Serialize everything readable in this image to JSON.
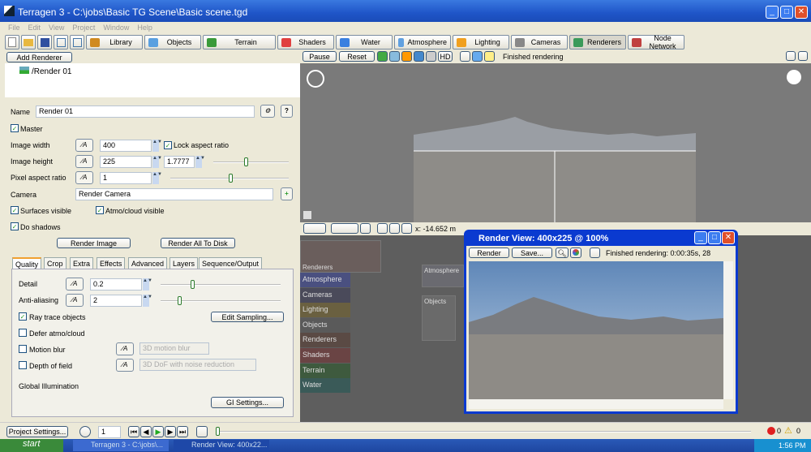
{
  "window": {
    "title": "Terragen 3 - C:\\jobs\\Basic TG Scene\\Basic scene.tgd",
    "minimize": "_",
    "maximize": "□",
    "close": "✕"
  },
  "menu": [
    "File",
    "Edit",
    "View",
    "Project",
    "Window",
    "Help"
  ],
  "toolbar": {
    "tabs": [
      {
        "label": "Library",
        "icon": "library-icon",
        "color": "#d08a20"
      },
      {
        "label": "Objects",
        "icon": "cube-icon",
        "color": "#5aa0e0"
      },
      {
        "label": "Terrain",
        "icon": "terrain-icon",
        "color": "#3a9a3a"
      },
      {
        "label": "Shaders",
        "icon": "sphere-icon",
        "color": "#e04040"
      },
      {
        "label": "Water",
        "icon": "water-drop-icon",
        "color": "#3a80e0"
      },
      {
        "label": "Atmosphere",
        "icon": "cloud-icon",
        "color": "#60a0e0"
      },
      {
        "label": "Lighting",
        "icon": "sun-icon",
        "color": "#f0a020"
      },
      {
        "label": "Cameras",
        "icon": "camera-icon",
        "color": "#888888"
      },
      {
        "label": "Renderers",
        "icon": "render-icon",
        "color": "#3a9a5a"
      },
      {
        "label": "Node Network",
        "icon": "node-network-icon",
        "color": "#c04040"
      }
    ]
  },
  "left": {
    "add_renderer": "Add Renderer",
    "tree_item": "/Render 01",
    "name_label": "Name",
    "name_value": "Render 01",
    "help": "?",
    "master": "Master",
    "image_width_label": "Image width",
    "image_width": "400",
    "lock_aspect": "Lock aspect ratio",
    "image_height_label": "Image height",
    "image_height": "225",
    "aspect": "1.7777",
    "pixel_aspect_label": "Pixel aspect ratio",
    "pixel_aspect": "1",
    "camera_label": "Camera",
    "camera_value": "Render Camera",
    "surfaces_visible": "Surfaces visible",
    "atmo_visible": "Atmo/cloud visible",
    "do_shadows": "Do shadows",
    "render_image": "Render Image",
    "render_all": "Render All To Disk",
    "tabs": [
      "Quality",
      "Crop",
      "Extra",
      "Effects",
      "Advanced",
      "Layers",
      "Sequence/Output"
    ],
    "detail_label": "Detail",
    "detail": "0.2",
    "aa_label": "Anti-aliasing",
    "aa": "2",
    "ray_trace": "Ray trace objects",
    "edit_sampling": "Edit Sampling...",
    "defer_atmo": "Defer atmo/cloud",
    "motion_blur": "Motion blur",
    "motion_blur_mode": "3D motion blur",
    "dof": "Depth of field",
    "dof_mode": "3D DoF with noise reduction",
    "gi_label": "Global Illumination",
    "gi_settings": "GI Settings..."
  },
  "viewport": {
    "pause": "Pause",
    "reset": "Reset",
    "hd": "HD",
    "status": "Finished rendering",
    "coord_x": "x: -14.652 m"
  },
  "nodes": {
    "header": "Renderers",
    "categories": [
      {
        "label": "Atmosphere",
        "color": "#4a5080"
      },
      {
        "label": "Cameras",
        "color": "#4a4a5a"
      },
      {
        "label": "Lighting",
        "color": "#6a6040"
      },
      {
        "label": "Objects",
        "color": "#5a5a5a"
      },
      {
        "label": "Renderers",
        "color": "#5a4a44"
      },
      {
        "label": "Shaders",
        "color": "#6a4444"
      },
      {
        "label": "Terrain",
        "color": "#3e5a3e"
      },
      {
        "label": "Water",
        "color": "#3a5a58"
      }
    ],
    "group_atmosphere": "Atmosphere",
    "group_objects": "Objects"
  },
  "render_view": {
    "title": "Render View: 400x225 @ 100%",
    "render": "Render",
    "save": "Save...",
    "status": "Finished rendering: 0:00:35s, 28"
  },
  "bottom": {
    "project_settings": "Project Settings...",
    "frame": "1",
    "errors": "0",
    "warnings": "0"
  },
  "taskbar": {
    "start": "start",
    "items": [
      "Terragen 3 - C:\\jobs\\...",
      "Render View: 400x22..."
    ],
    "clock": "1:56 PM"
  }
}
